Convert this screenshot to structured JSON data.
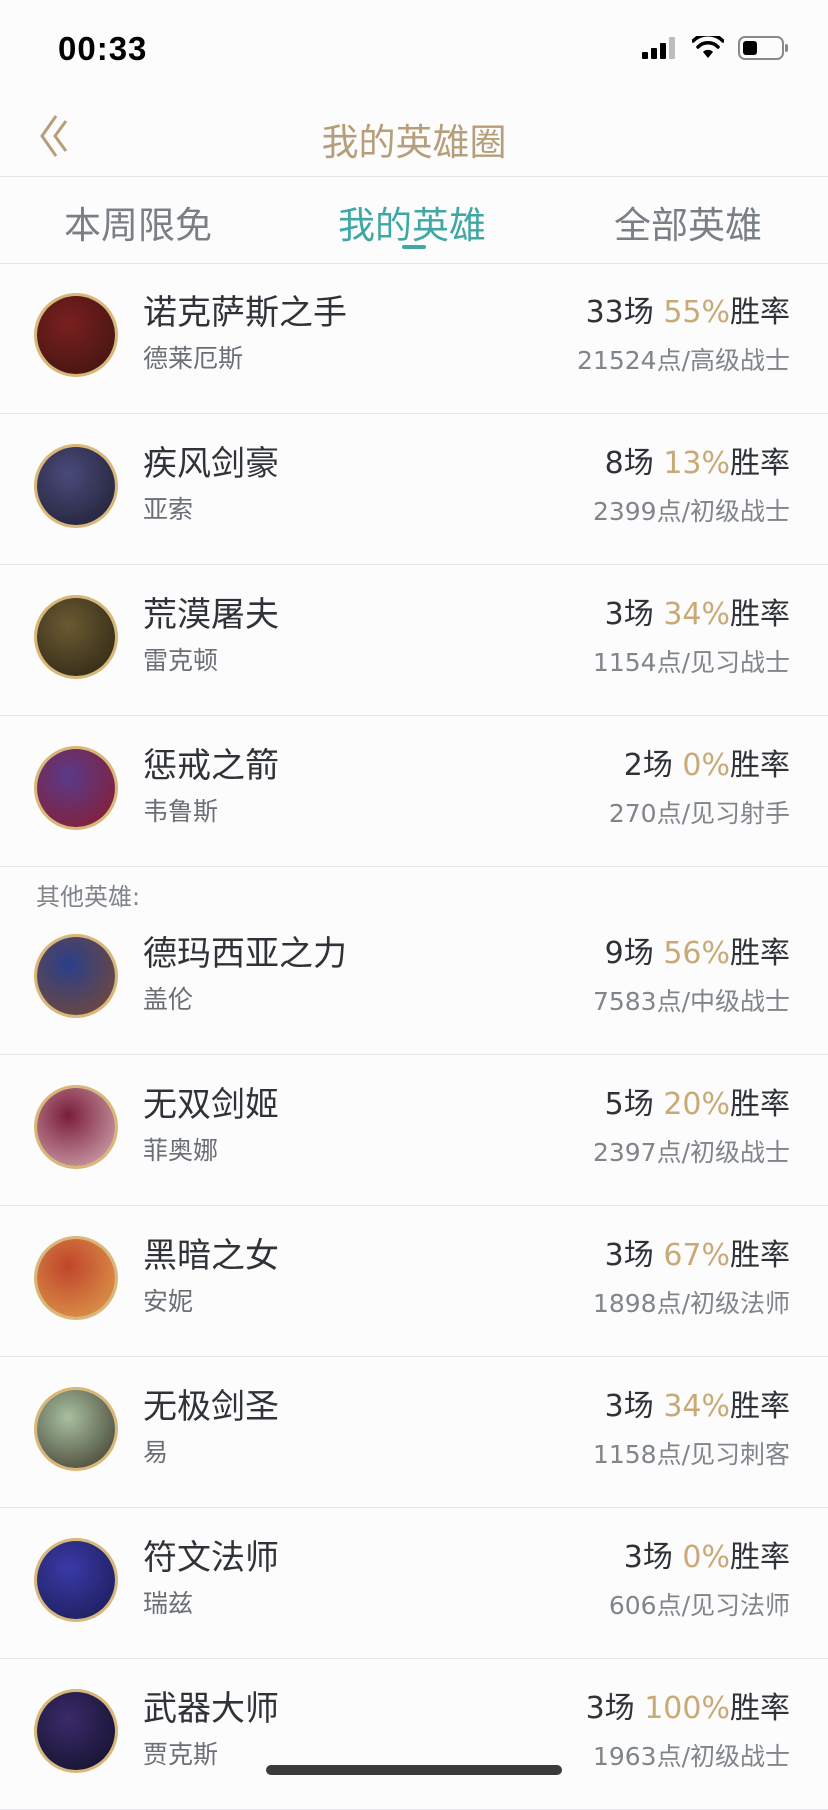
{
  "status": {
    "time": "00:33"
  },
  "nav": {
    "title": "我的英雄圈"
  },
  "tabs": [
    {
      "label": "本周限免",
      "active": false
    },
    {
      "label": "我的英雄",
      "active": true
    },
    {
      "label": "全部英雄",
      "active": false
    }
  ],
  "my_heroes": [
    {
      "title": "诺克萨斯之手",
      "name": "德莱厄斯",
      "games": "33场",
      "rate": "55%",
      "rate_suffix": "胜率",
      "points": "21524点/高级战士",
      "avatar_colors": [
        "#7a1f1f",
        "#3b1410"
      ]
    },
    {
      "title": "疾风剑豪",
      "name": "亚索",
      "games": "8场",
      "rate": "13%",
      "rate_suffix": "胜率",
      "points": "2399点/初级战士",
      "avatar_colors": [
        "#4a4a7a",
        "#1e1e30"
      ]
    },
    {
      "title": "荒漠屠夫",
      "name": "雷克顿",
      "games": "3场",
      "rate": "34%",
      "rate_suffix": "胜率",
      "points": "1154点/见习战士",
      "avatar_colors": [
        "#6b5a32",
        "#2a2413"
      ]
    },
    {
      "title": "惩戒之箭",
      "name": "韦鲁斯",
      "games": "2场",
      "rate": "0%",
      "rate_suffix": "胜率",
      "points": "270点/见习射手",
      "avatar_colors": [
        "#5a3a8a",
        "#8a1c2a"
      ]
    }
  ],
  "other_label": "其他英雄:",
  "other_heroes": [
    {
      "title": "德玛西亚之力",
      "name": "盖伦",
      "games": "9场",
      "rate": "56%",
      "rate_suffix": "胜率",
      "points": "7583点/中级战士",
      "avatar_colors": [
        "#2b3f8a",
        "#7a4a30"
      ]
    },
    {
      "title": "无双剑姬",
      "name": "菲奥娜",
      "games": "5场",
      "rate": "20%",
      "rate_suffix": "胜率",
      "points": "2397点/初级战士",
      "avatar_colors": [
        "#7a1e3a",
        "#d8b0b8"
      ]
    },
    {
      "title": "黑暗之女",
      "name": "安妮",
      "games": "3场",
      "rate": "67%",
      "rate_suffix": "胜率",
      "points": "1898点/初级法师",
      "avatar_colors": [
        "#c0452a",
        "#e0a050"
      ]
    },
    {
      "title": "无极剑圣",
      "name": "易",
      "games": "3场",
      "rate": "34%",
      "rate_suffix": "胜率",
      "points": "1158点/见习刺客",
      "avatar_colors": [
        "#a8c0a0",
        "#3a3528"
      ]
    },
    {
      "title": "符文法师",
      "name": "瑞兹",
      "games": "3场",
      "rate": "0%",
      "rate_suffix": "胜率",
      "points": "606点/见习法师",
      "avatar_colors": [
        "#3a3aa8",
        "#1a1a50"
      ]
    },
    {
      "title": "武器大师",
      "name": "贾克斯",
      "games": "3场",
      "rate": "100%",
      "rate_suffix": "胜率",
      "points": "1963点/初级战士",
      "avatar_colors": [
        "#3a2a6a",
        "#101028"
      ]
    }
  ],
  "colors": {
    "accent": "#3fa7a5",
    "gold": "#c9a976",
    "title": "#b69e7a"
  }
}
